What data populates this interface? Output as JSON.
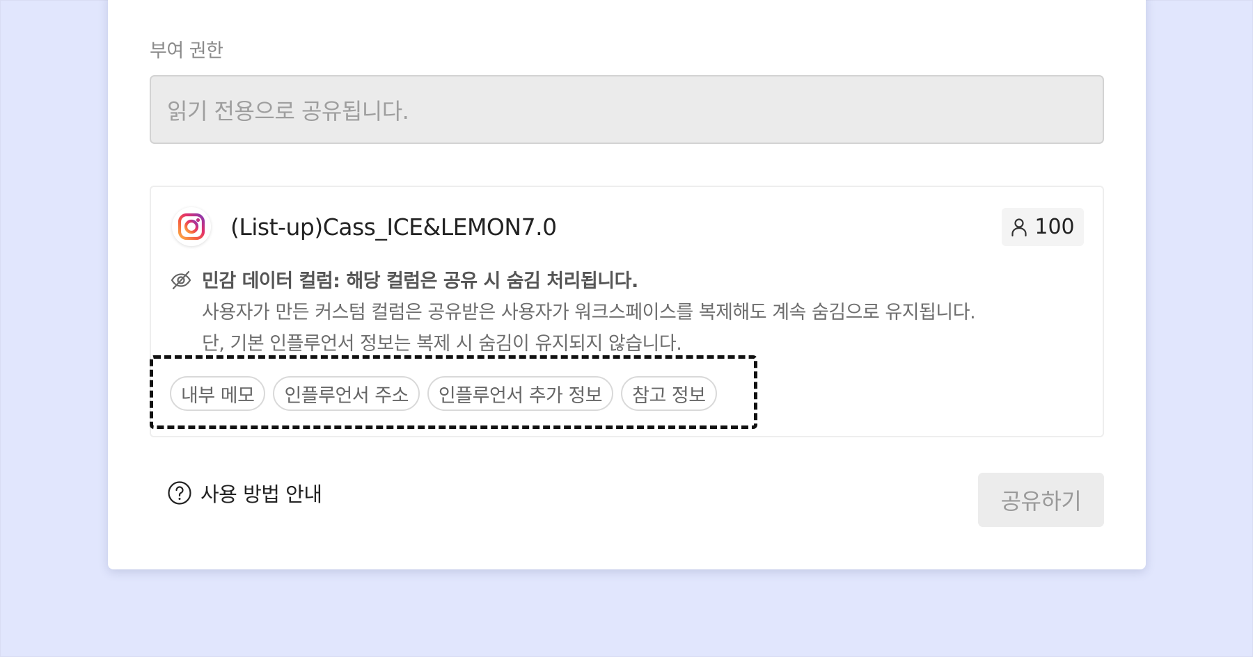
{
  "permission": {
    "label": "부여 권한",
    "value": "읽기 전용으로 공유됩니다."
  },
  "list": {
    "platform_icon": "instagram-icon",
    "name": "(List-up)Cass_ICE&LEMON7.0",
    "member_icon": "person-icon",
    "member_count": "100"
  },
  "sensitive_notice": {
    "icon": "eye-off-icon",
    "title": "민감 데이터 컬럼: 해당 컬럼은 공유 시 숨김 처리됩니다.",
    "line1": "사용자가 만든 커스텀 컬럼은 공유받은 사용자가 워크스페이스를 복제해도 계속 숨김으로 유지됩니다.",
    "line2": "단, 기본 인플루언서 정보는 복제 시 숨김이 유지되지 않습니다."
  },
  "hidden_columns": [
    "내부 메모",
    "인플루언서 주소",
    "인플루언서 추가 정보",
    "참고 정보"
  ],
  "footer": {
    "help_icon": "question-circle-icon",
    "help_label": "사용 방법 안내",
    "share_label": "공유하기"
  },
  "colors": {
    "background": "#e1e6fd",
    "dashed_highlight": "#111111",
    "disabled_button": "#ececec"
  }
}
